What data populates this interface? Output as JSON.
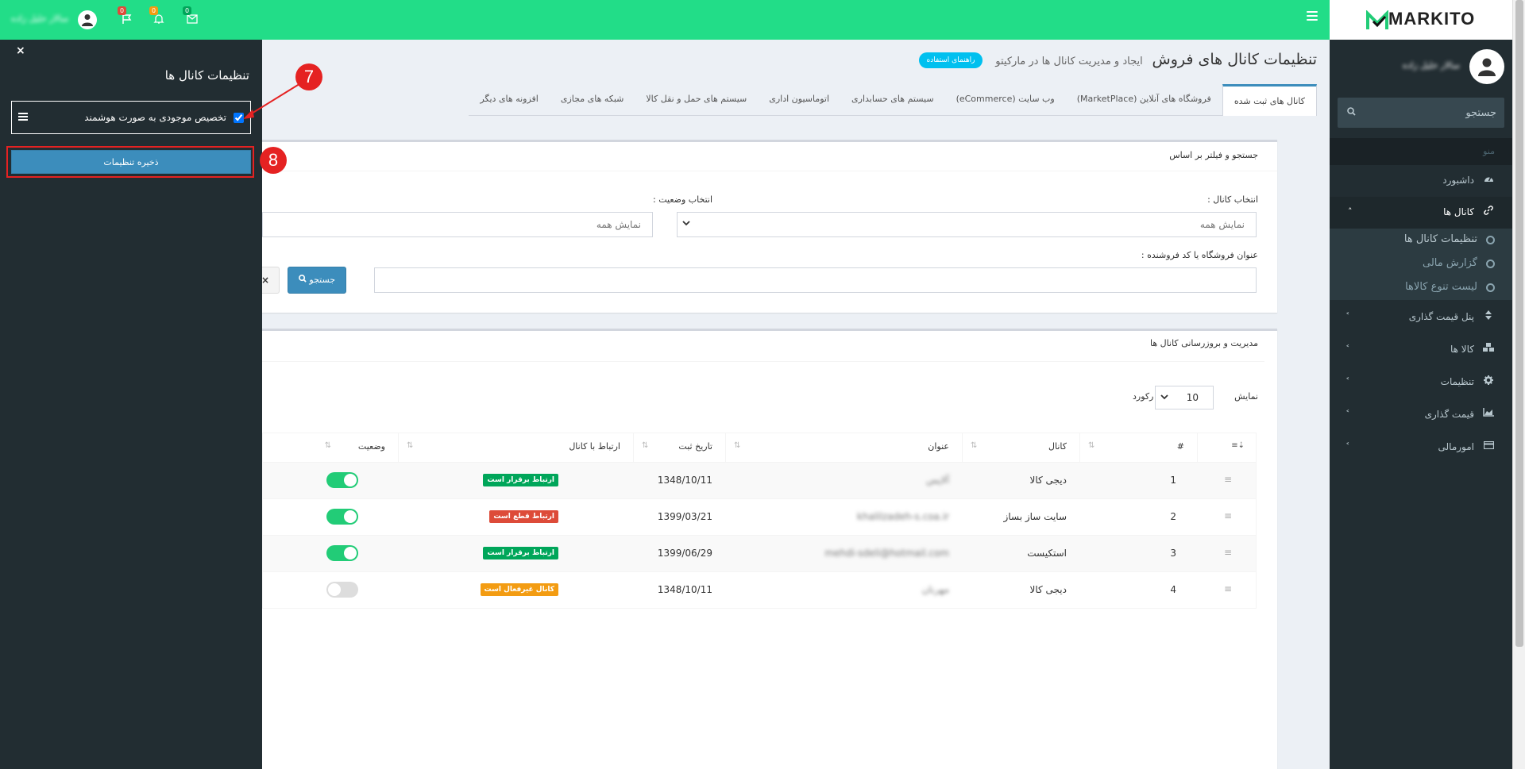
{
  "topbar": {
    "user_name": "سالار خلیل زاده",
    "notifications": [
      {
        "icon": "envelope-icon",
        "count": "0",
        "badge_color": "#00a65a"
      },
      {
        "icon": "bell-icon",
        "count": "0",
        "badge_color": "#f39c12"
      },
      {
        "icon": "flag-icon",
        "count": "0",
        "badge_color": "#dd4b39"
      }
    ]
  },
  "logo": {
    "word": "MARKITO",
    "accent": "#22cc77"
  },
  "sidebar": {
    "user_name": "سالار خلیل زاده",
    "search_placeholder": "جستجو",
    "header": "منو",
    "items": [
      {
        "label": "داشبورد",
        "icon": "dashboard-icon"
      },
      {
        "label": "کانال ها",
        "icon": "link-icon",
        "chevron": "˄"
      },
      {
        "label": "پنل قیمت گذاری",
        "icon": "sort-icon",
        "chevron": "˂"
      },
      {
        "label": "کالا ها",
        "icon": "cubes-icon",
        "chevron": "˂"
      },
      {
        "label": "تنظیمات",
        "icon": "gear-icon",
        "chevron": "˂"
      },
      {
        "label": "قیمت گذاری",
        "icon": "area-chart-icon",
        "chevron": "˂"
      },
      {
        "label": "امورمالی",
        "icon": "credit-card-icon",
        "chevron": "˂"
      }
    ],
    "subitems": [
      {
        "label": "تنظیمات کانال ها"
      },
      {
        "label": "گزارش مالی"
      },
      {
        "label": "لیست تنوع کالاها"
      }
    ]
  },
  "page": {
    "title": "تنظیمات کانال های فروش",
    "subtitle": "ایجاد و مدیریت کانال ها در مارکیتو",
    "help_button": "راهنمای استفاده"
  },
  "tabs": [
    {
      "label": "کانال های ثبت شده"
    },
    {
      "label": "فروشگاه های آنلاین (MarketPlace)"
    },
    {
      "label": "وب سایت (eCommerce)"
    },
    {
      "label": "سیستم های حسابداری"
    },
    {
      "label": "اتوماسیون اداری"
    },
    {
      "label": "سیستم های حمل و نقل کالا"
    },
    {
      "label": "شبکه های مجازی"
    },
    {
      "label": "افزونه های دیگر"
    }
  ],
  "filter": {
    "title": "جستجو و فیلتر بر اساس",
    "channel_label": "انتخاب کانال :",
    "channel_value": "نمایش همه",
    "status_label": "انتخاب وضعیت :",
    "status_value": "نمایش همه",
    "store_label": "عنوان فروشگاه یا کد فروشنده :",
    "store_value": "",
    "search_button": "جستجو",
    "clear_button": "×"
  },
  "manage": {
    "title": "مدیریت و بروزرسانی کانال ها",
    "show_label": "نمایش",
    "page_size": "10",
    "records_label": "رکورد"
  },
  "table": {
    "headers": [
      "#",
      "کانال",
      "عنوان",
      "تاریخ ثبت",
      "ارتباط با کانال",
      "وضعیت"
    ],
    "rows": [
      {
        "num": "1",
        "channel": "دیجی کالا",
        "title": "آلاپس",
        "date": "1348/10/11",
        "link": "ارتباط برقرار است",
        "link_color": "#00a65a",
        "enabled": true
      },
      {
        "num": "2",
        "channel": "سایت ساز بساز",
        "title": "khalilzadeh-s.coa.ir",
        "date": "1399/03/21",
        "link": "ارتباط قطع است",
        "link_color": "#dd4b39",
        "enabled": true
      },
      {
        "num": "3",
        "channel": "استکیست",
        "title": "mehdi-sdeli@hotmail.com",
        "date": "1399/06/29",
        "link": "ارتباط برقرار است",
        "link_color": "#00a65a",
        "enabled": true
      },
      {
        "num": "4",
        "channel": "دیجی کالا",
        "title": "مهرنان",
        "date": "1348/10/11",
        "link": "کانال غیرفعال است",
        "link_color": "#f39c12",
        "enabled": false
      }
    ]
  },
  "panel": {
    "close": "×",
    "title": "تنظیمات کانال ها",
    "option_label": "تخصیص موجودی به صورت هوشمند",
    "option_checked": true,
    "save_button": "ذخیره تنظیمات"
  },
  "markers": {
    "m7": "7",
    "m8": "8"
  }
}
